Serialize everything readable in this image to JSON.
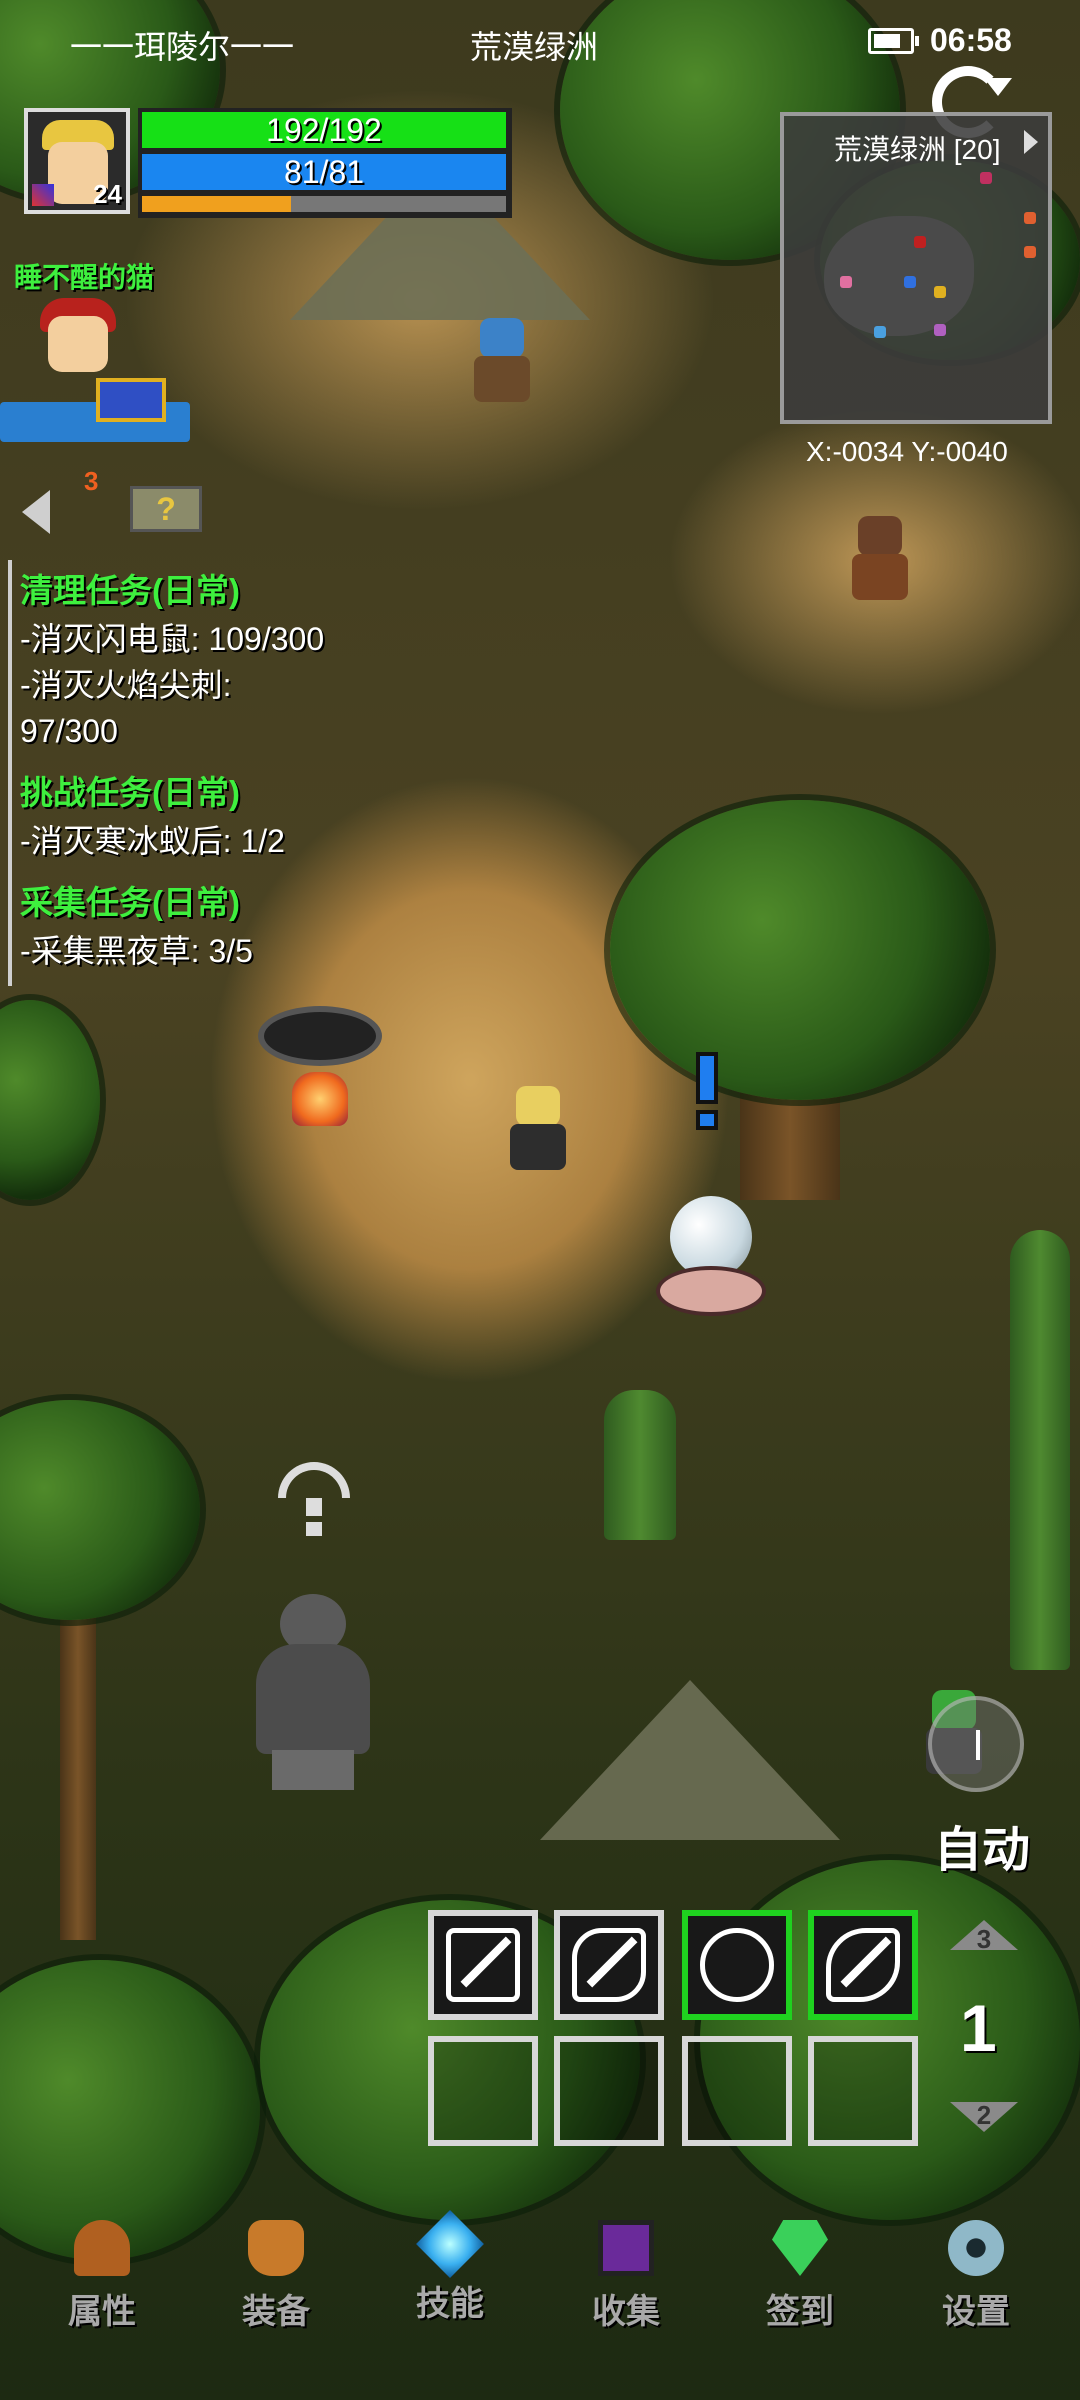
{
  "status_bar": {
    "player_title": "一一珥陵尔一一",
    "zone": "荒漠绿洲",
    "time": "06:58"
  },
  "player": {
    "level": "24",
    "hp": "192/192",
    "mp": "81/81",
    "hp_fraction": 1.0,
    "mp_fraction": 1.0,
    "xp_fraction": 0.41
  },
  "minimap": {
    "title": "荒漠绿洲 [20]",
    "coords": "X:-0034  Y:-0040"
  },
  "party": {
    "ally_name": "睡不醒的猫",
    "ally_count": "3",
    "help_label": "?"
  },
  "quests": [
    {
      "title": "清理任务(日常)",
      "items": [
        "-消灭闪电鼠: 109/300",
        "-消灭火焰尖刺:",
        "97/300"
      ]
    },
    {
      "title": "挑战任务(日常)",
      "items": [
        "-消灭寒冰蚁后: 1/2"
      ]
    },
    {
      "title": "采集任务(日常)",
      "items": [
        "-采集黑夜草: 3/5"
      ]
    }
  ],
  "controls": {
    "auto_label": "自动",
    "page_up": "3",
    "page_current": "1",
    "page_down": "2"
  },
  "skills": {
    "row1": [
      {
        "icon": "claw-skill-icon",
        "active": false
      },
      {
        "icon": "fire-slash-skill-icon",
        "active": false
      },
      {
        "icon": "gear-burst-skill-icon",
        "active": true
      },
      {
        "icon": "blade-skill-icon",
        "active": true
      }
    ],
    "row2_empty_slots": 4
  },
  "nav": [
    {
      "label": "属性",
      "icon": "helmet-icon",
      "color": "#b06020"
    },
    {
      "label": "装备",
      "icon": "pot-icon",
      "color": "#c87a2a"
    },
    {
      "label": "技能",
      "icon": "crystal-icon",
      "color": "#3ab0f0"
    },
    {
      "label": "收集",
      "icon": "book-icon",
      "color": "#6a2a9a"
    },
    {
      "label": "签到",
      "icon": "gem-icon",
      "color": "#3ad05a"
    },
    {
      "label": "设置",
      "icon": "gear-icon",
      "color": "#8fb8c8"
    }
  ],
  "colors": {
    "hp": "#16e016",
    "mp": "#1a86f0",
    "xp": "#f0a01e",
    "quest_title": "#3ef03e",
    "active_slot": "#1fd21f"
  }
}
